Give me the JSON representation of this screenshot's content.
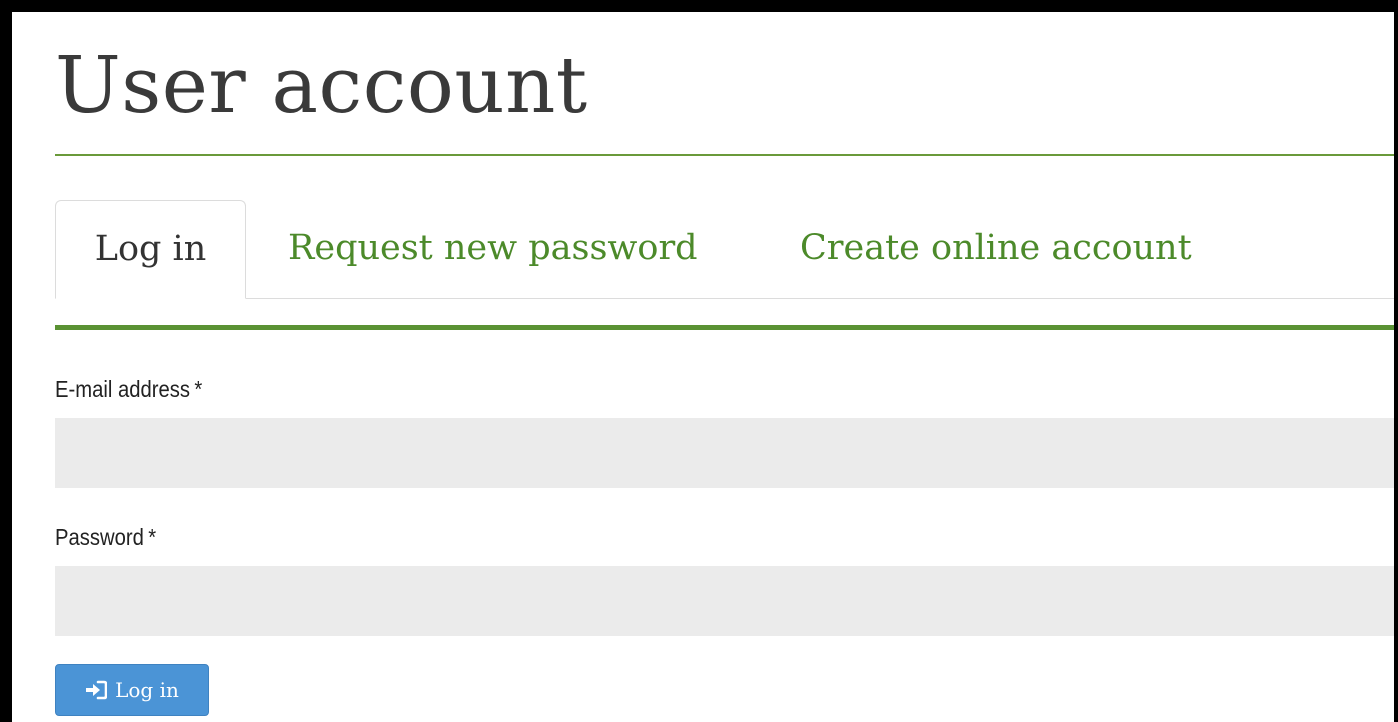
{
  "page": {
    "title": "User account"
  },
  "tabs": [
    {
      "label": "Log in",
      "active": true
    },
    {
      "label": "Request new password",
      "active": false
    },
    {
      "label": "Create online account",
      "active": false
    }
  ],
  "form": {
    "email": {
      "label": "E-mail address",
      "required_marker": "*",
      "value": "",
      "placeholder": ""
    },
    "password": {
      "label": "Password",
      "required_marker": "*",
      "value": "",
      "placeholder": ""
    },
    "submit": {
      "label": "Log in",
      "icon": "sign-in-icon"
    }
  },
  "colors": {
    "accent_green": "#5a9233",
    "tab_link_green": "#4c8a2a",
    "button_blue": "#4b94d6",
    "input_background": "#ebebeb"
  }
}
